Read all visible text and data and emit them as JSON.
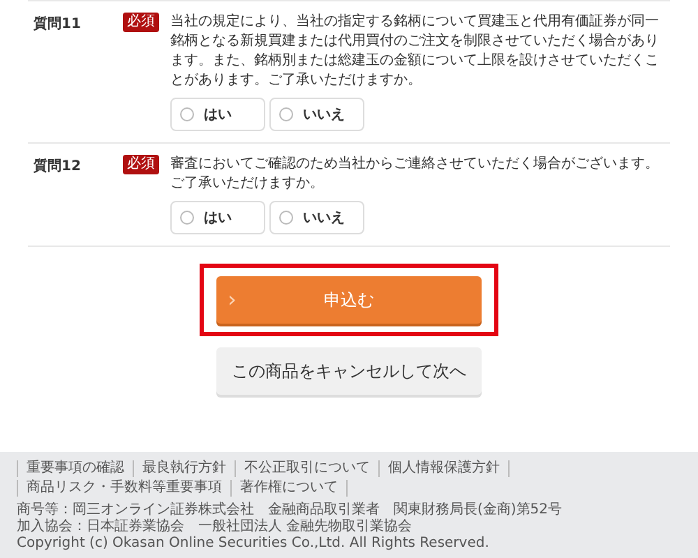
{
  "questions": [
    {
      "label": "質問11",
      "badge": "必須",
      "text": "当社の規定により、当社の指定する銘柄について買建玉と代用有価証券が同一銘柄となる新規買建または代用買付のご注文を制限させていただく場合があります。また、銘柄別または総建玉の金額について上限を設けさせていただくことがあります。ご了承いただけますか。",
      "options": [
        {
          "label": "はい",
          "selected": false
        },
        {
          "label": "いいえ",
          "selected": false
        }
      ]
    },
    {
      "label": "質問12",
      "badge": "必須",
      "text": "審査においてご確認のため当社からご連絡させていただく場合がございます。ご了承いただけますか。",
      "options": [
        {
          "label": "はい",
          "selected": false
        },
        {
          "label": "いいえ",
          "selected": false
        }
      ]
    }
  ],
  "submit": {
    "arrow": "›",
    "label": "申込む"
  },
  "cancel": {
    "label": "この商品をキャンセルして次へ"
  },
  "footer": {
    "links": [
      "重要事項の確認",
      "最良執行方針",
      "不公正取引について",
      "個人情報保護方針",
      "商品リスク・手数料等重要事項",
      "著作権について"
    ],
    "lines": [
      "商号等：岡三オンライン証券株式会社　金融商品取引業者　関東財務局長(金商)第52号",
      "加入協会：日本証券業協会　一般社団法人 金融先物取引業協会",
      "Copyright (c) Okasan Online Securities Co.,Ltd. All Rights Reserved."
    ]
  }
}
